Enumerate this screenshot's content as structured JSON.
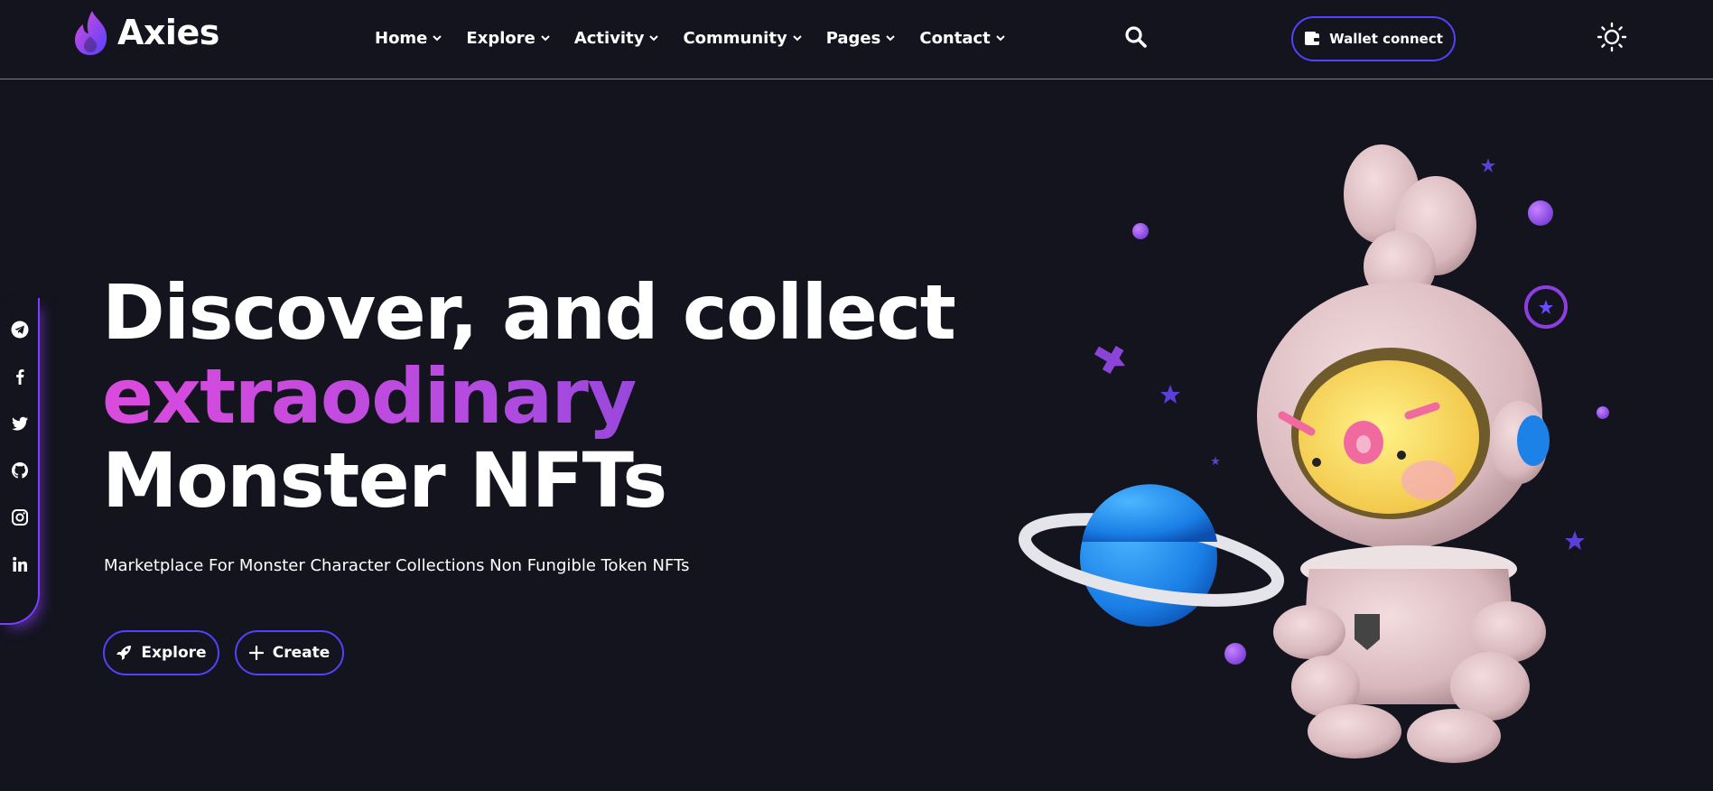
{
  "brand": {
    "name": "Axies",
    "accent": "#5142fc",
    "flame_colors": [
      "#da4bdd",
      "#5142fc"
    ]
  },
  "nav": {
    "items": [
      {
        "label": "Home"
      },
      {
        "label": "Explore"
      },
      {
        "label": "Activity"
      },
      {
        "label": "Community"
      },
      {
        "label": "Pages"
      },
      {
        "label": "Contact"
      }
    ],
    "search_icon": "search-icon",
    "wallet_label": "Wallet connect",
    "theme_icon": "sun-icon"
  },
  "social": [
    "telegram-icon",
    "facebook-icon",
    "twitter-icon",
    "github-icon",
    "instagram-icon",
    "linkedin-icon"
  ],
  "hero": {
    "line1": "Discover, and collect",
    "line2": "extraodinary",
    "line3": "Monster NFTs",
    "subtitle": "Marketplace For Monster Character Collections Non Fungible Token NFTs",
    "explore_label": "Explore",
    "create_label": "Create"
  },
  "colors": {
    "background": "#14141f",
    "gradient": [
      "#da4bdd",
      "#5f3fd3"
    ]
  }
}
